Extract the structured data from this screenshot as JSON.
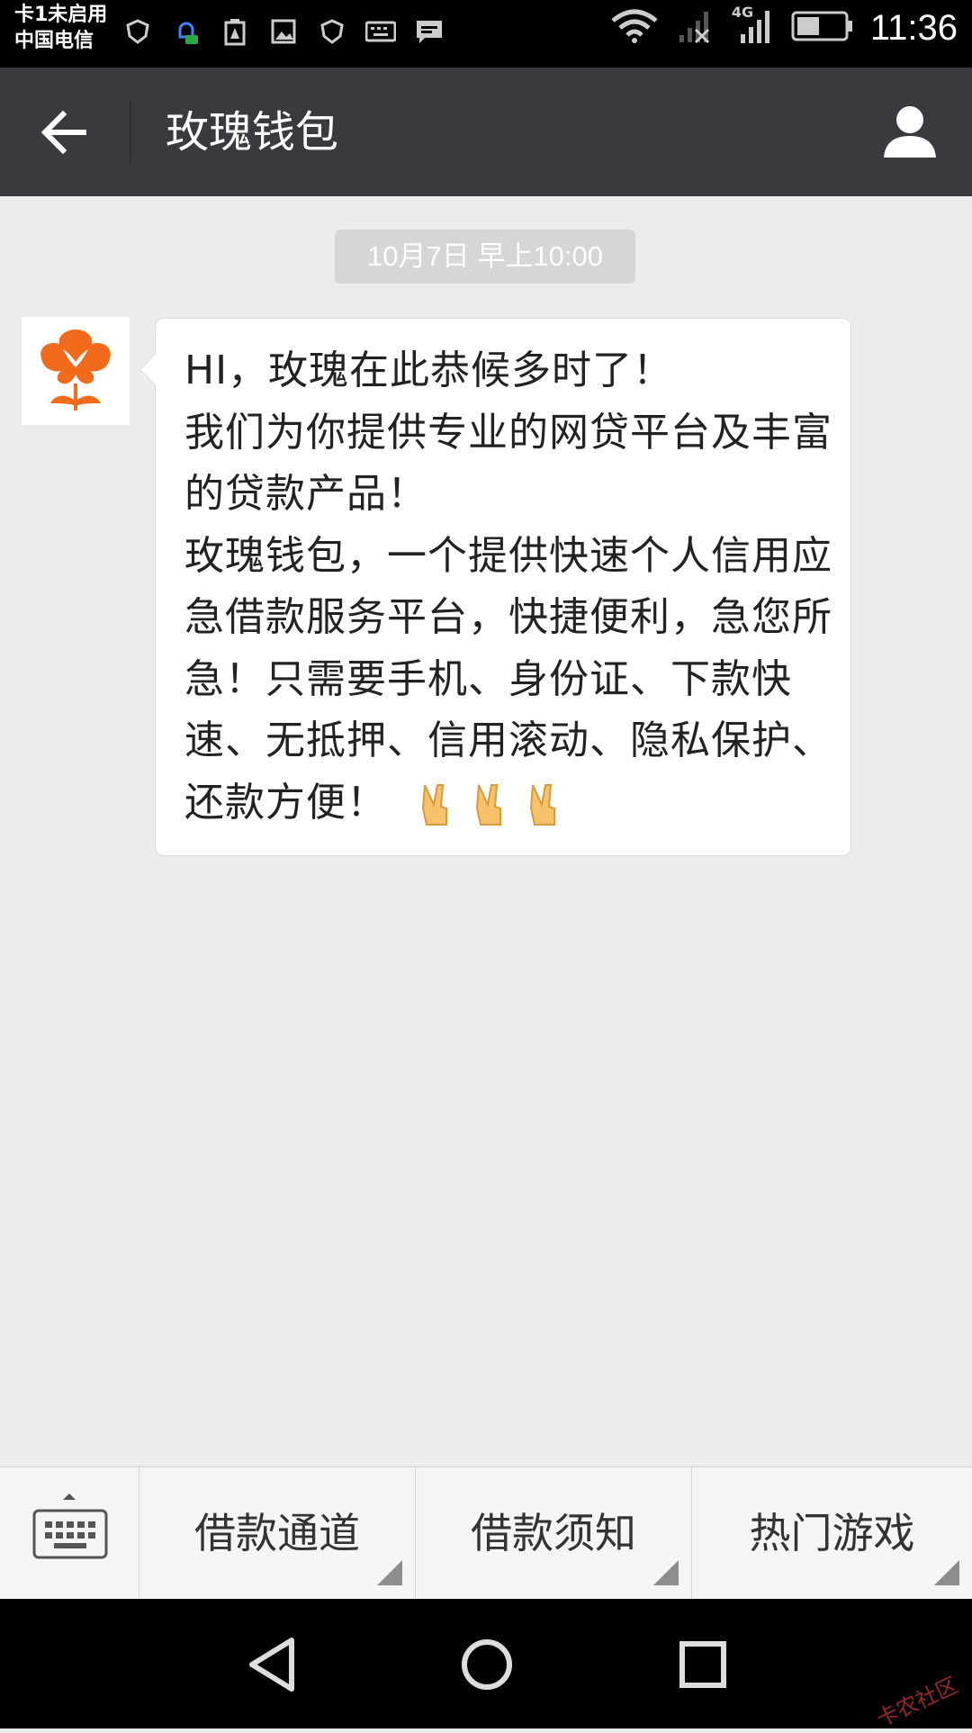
{
  "status_bar": {
    "sim_status": "卡1未启用",
    "carrier": "中国电信",
    "network_type": "4G",
    "time": "11:36"
  },
  "header": {
    "title": "玫瑰钱包"
  },
  "chat": {
    "timestamp": "10月7日 早上10:00",
    "messages": [
      {
        "sender": "玫瑰钱包",
        "text": "HI，玫瑰在此恭候多时了！\n我们为你提供专业的网贷平台及丰富的贷款产品！\n玫瑰钱包，一个提供快速个人信用应急借款服务平台，快捷便利，急您所急！只需要手机、身份证、下款快速、无抵押、信用滚动、隐私保护、还款方便！",
        "emoji": [
          "victory-hand",
          "victory-hand",
          "victory-hand"
        ]
      }
    ]
  },
  "menu": {
    "items": [
      {
        "label": "借款通道"
      },
      {
        "label": "借款须知"
      },
      {
        "label": "热门游戏"
      }
    ]
  },
  "watermark": "卡农社区",
  "colors": {
    "title_bar": "#393a3f",
    "background": "#ececec",
    "avatar_accent": "#f26b1d"
  }
}
